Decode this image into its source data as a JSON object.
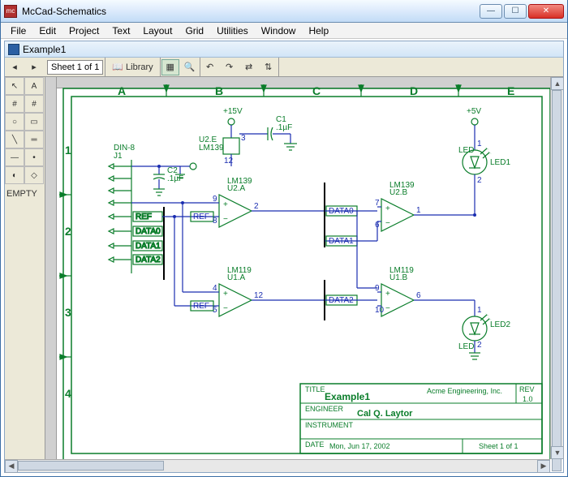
{
  "app": {
    "title": "McCad-Schematics",
    "menus": [
      "File",
      "Edit",
      "Project",
      "Text",
      "Layout",
      "Grid",
      "Utilities",
      "Window",
      "Help"
    ]
  },
  "document": {
    "name": "Example1"
  },
  "toolbar": {
    "sheet_label": "Sheet 1 of 1",
    "library_label": "Library"
  },
  "palette": {
    "empty_label": "EMPTY"
  },
  "schematic": {
    "columns": [
      "A",
      "B",
      "C",
      "D",
      "E"
    ],
    "rows": [
      "1",
      "2",
      "3",
      "4"
    ],
    "power_rails": [
      {
        "name": "+15V",
        "value": "+15V"
      },
      {
        "name": "+5V",
        "value": "+5V"
      }
    ],
    "components": {
      "j1": {
        "ref": "J1",
        "type": "DIN-8"
      },
      "c1": {
        "ref": "C1",
        "value": ".1µF"
      },
      "c2": {
        "ref": "C2",
        "value": ".1µF"
      },
      "u2e": {
        "ref": "U2.E",
        "part": "LM139",
        "pins": {
          "topin": "3",
          "bot": "12"
        }
      },
      "u2a": {
        "ref": "U2.A",
        "part": "LM139",
        "pins": {
          "in_plus": "9",
          "in_minus": "8",
          "out": "2"
        }
      },
      "u2b": {
        "ref": "U2.B",
        "part": "LM139",
        "pins": {
          "in_plus": "7",
          "in_minus": "6",
          "out": "1"
        }
      },
      "u1a": {
        "ref": "U1.A",
        "part": "LM119",
        "pins": {
          "in_plus": "4",
          "in_minus": "5",
          "out": "12"
        }
      },
      "u1b": {
        "ref": "U1.B",
        "part": "LM119",
        "pins": {
          "in_plus": "9",
          "in_minus": "10",
          "out": "6"
        }
      },
      "led1": {
        "ref": "LED1",
        "type": "LED",
        "pin1": "1",
        "pin2": "2"
      },
      "led2": {
        "ref": "LED2",
        "type": "LED",
        "pin1": "1",
        "pin2": "2"
      }
    },
    "nets": [
      "REF",
      "DATA0",
      "DATA1",
      "DATA2"
    ],
    "titleblock": {
      "title_hdr": "TITLE",
      "title": "Example1",
      "company": "Acme Engineering, Inc.",
      "rev_hdr": "REV",
      "rev": "1.0",
      "engineer_hdr": "ENGINEER",
      "engineer": "Cal Q. Laytor",
      "instrument_hdr": "INSTRUMENT",
      "date_hdr": "DATE",
      "date": "Mon, Jun 17, 2002",
      "sheet": "Sheet 1 of 1"
    }
  }
}
